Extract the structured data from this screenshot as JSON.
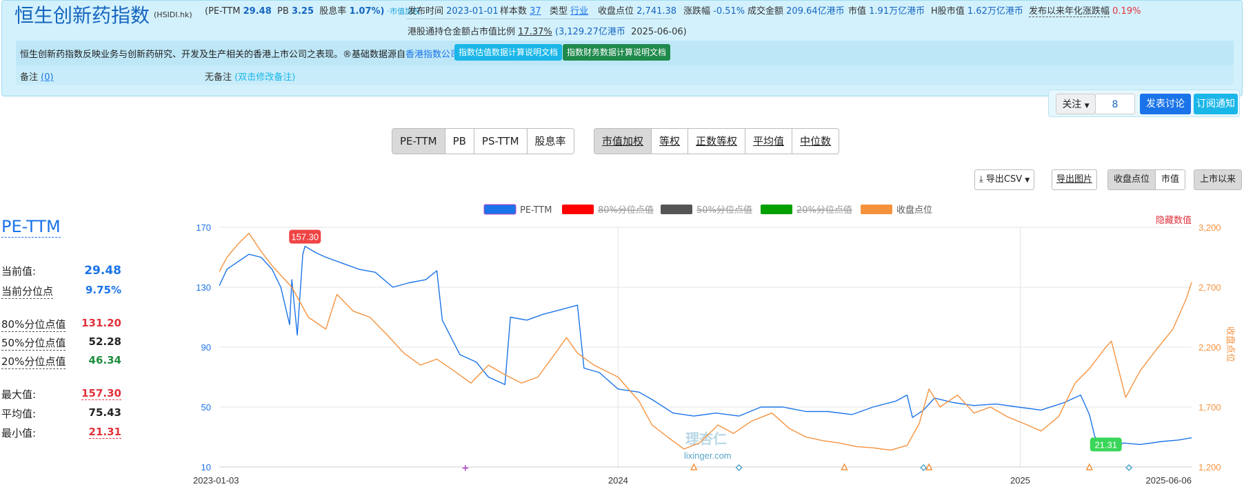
{
  "header": {
    "index_name": "恒生创新药指数",
    "index_code": "(HSIDI.hk)",
    "pe_label": "(PE-TTM",
    "pe_value": "29.48",
    "pb_label": "PB",
    "pb_value": "3.25",
    "dy_label": "股息率",
    "dy_value": "1.07%)",
    "weight_tag": "·市值加权",
    "publish_label": "发布时间",
    "publish_value": "2023-01-01",
    "sample_label": "样本数",
    "sample_value": "37",
    "type_label": "类型",
    "type_value": "行业",
    "close_label": "收盘点位",
    "close_value": "2,741.38",
    "change_label": "涨跌幅",
    "change_value": "-0.51%",
    "turnover_label": "成交金额",
    "turnover_value": "209.64亿港币",
    "mktcap_label": "市值",
    "mktcap_value": "1.91万亿港币",
    "hcap_label": "H股市值",
    "hcap_value": "1.62万亿港币",
    "annual_label": "发布以来年化涨跌幅",
    "annual_value": "0.19%",
    "southbound_label": "港股通持仓金额占市值比例",
    "southbound_pct": "17.37%",
    "southbound_amount": "(3,129.27亿港币",
    "southbound_date": "2025-06-06)",
    "description_prefix": "恒生创新药指数反映业务与创新药研究、开发及生产相关的香港上市公司之表现。®基础数据源自",
    "description_link": "香港指数公司",
    "description_suffix": "。",
    "doc_btn_valuation": "指数估值数据计算说明文档",
    "doc_btn_financial": "指数财务数据计算说明文档",
    "note_label": "备注",
    "note_count": "(0)",
    "note_value": "无备注",
    "note_edit": "(双击修改备注)"
  },
  "actions": {
    "follow": "关注",
    "follow_count": "8",
    "post": "发表讨论",
    "subscribe": "订阅通知"
  },
  "metric_tabs": [
    "PE-TTM",
    "PB",
    "PS-TTM",
    "股息率"
  ],
  "weight_tabs": [
    "市值加权",
    "等权",
    "正数等权",
    "平均值",
    "中位数"
  ],
  "tools": {
    "export_csv": "导出CSV",
    "export_img": "导出图片",
    "mode_close": "收盘点位",
    "mode_cap": "市值",
    "range": "上市以来"
  },
  "stats": {
    "title": "PE-TTM",
    "current_label": "当前值:",
    "current_value": "29.48",
    "pct_label": "当前分位点",
    "pct_value": "9.75%",
    "p80_label": "80%分位点值",
    "p80_value": "131.20",
    "p50_label": "50%分位点值",
    "p50_value": "52.28",
    "p20_label": "20%分位点值",
    "p20_value": "46.34",
    "max_label": "最大值:",
    "max_value": "157.30",
    "avg_label": "平均值:",
    "avg_value": "75.43",
    "min_label": "最小值:",
    "min_value": "21.31"
  },
  "colors": {
    "pe": "#1a73e8",
    "p80": "#ff0000",
    "p50": "#555555",
    "p20": "#00a000",
    "close": "#f5923e",
    "red": "#e0313b",
    "green": "#1e8e3e"
  },
  "chart_data": {
    "type": "line",
    "legend": [
      "PE-TTM",
      "80%分位点值",
      "50%分位点值",
      "20%分位点值",
      "收盘点位"
    ],
    "hidden_series": [
      "80%分位点值",
      "50%分位点值",
      "20%分位点值"
    ],
    "legend_position": "top-center",
    "hide_values_label": "隐藏数值",
    "y_left_ticks": [
      10,
      50,
      90,
      130,
      170
    ],
    "y_left_range": [
      10,
      170
    ],
    "y_right_ticks": [
      1200,
      1700,
      2200,
      2700,
      3200
    ],
    "y_right_tick_labels": [
      "1,200",
      "1,700",
      "2,200",
      "2,700",
      "3,200"
    ],
    "y_right_range": [
      1200,
      3200
    ],
    "y_right_label": "收盘点位",
    "x_range": [
      "2023-01-03",
      "2025-06-06"
    ],
    "x_tick_labels": [
      "2023-01-03",
      "2024",
      "2025",
      "2025-06-06"
    ],
    "x_ticks": [
      "2023-01-03",
      "2024-01-01",
      "2025-01-01",
      "2025-06-06"
    ],
    "grid": true,
    "annotations": [
      {
        "label": "157.30",
        "date": "2023-03-22",
        "value": 157.3,
        "kind": "max"
      },
      {
        "label": "21.31",
        "date": "2025-03-20",
        "value": 21.31,
        "kind": "min"
      }
    ],
    "watermark": [
      "理杏仁",
      "lixinger.com"
    ],
    "series": [
      {
        "name": "PE-TTM",
        "axis": "left",
        "points": [
          [
            "2023-01-03",
            131
          ],
          [
            "2023-01-10",
            142
          ],
          [
            "2023-01-20",
            147
          ],
          [
            "2023-01-30",
            152
          ],
          [
            "2023-02-10",
            150
          ],
          [
            "2023-02-20",
            142
          ],
          [
            "2023-02-28",
            130
          ],
          [
            "2023-03-08",
            105
          ],
          [
            "2023-03-10",
            135
          ],
          [
            "2023-03-15",
            98
          ],
          [
            "2023-03-20",
            152
          ],
          [
            "2023-03-22",
            157.3
          ],
          [
            "2023-04-01",
            153
          ],
          [
            "2023-04-10",
            150
          ],
          [
            "2023-04-25",
            146
          ],
          [
            "2023-05-10",
            142
          ],
          [
            "2023-05-25",
            140
          ],
          [
            "2023-06-10",
            130
          ],
          [
            "2023-06-25",
            133
          ],
          [
            "2023-07-10",
            135
          ],
          [
            "2023-07-20",
            141
          ],
          [
            "2023-07-25",
            108
          ],
          [
            "2023-08-10",
            85
          ],
          [
            "2023-08-25",
            80
          ],
          [
            "2023-09-05",
            70
          ],
          [
            "2023-09-20",
            65
          ],
          [
            "2023-09-25",
            110
          ],
          [
            "2023-10-10",
            108
          ],
          [
            "2023-10-25",
            112
          ],
          [
            "2023-11-10",
            115
          ],
          [
            "2023-11-25",
            118
          ],
          [
            "2023-12-01",
            76
          ],
          [
            "2023-12-15",
            73
          ],
          [
            "2024-01-01",
            62
          ],
          [
            "2024-01-20",
            60
          ],
          [
            "2024-02-01",
            55
          ],
          [
            "2024-02-20",
            46
          ],
          [
            "2024-03-10",
            44
          ],
          [
            "2024-03-30",
            46
          ],
          [
            "2024-04-20",
            44
          ],
          [
            "2024-05-10",
            50
          ],
          [
            "2024-05-30",
            50
          ],
          [
            "2024-06-20",
            47
          ],
          [
            "2024-07-10",
            47
          ],
          [
            "2024-08-01",
            45
          ],
          [
            "2024-08-20",
            50
          ],
          [
            "2024-09-10",
            54
          ],
          [
            "2024-09-20",
            58
          ],
          [
            "2024-09-25",
            43
          ],
          [
            "2024-10-05",
            48
          ],
          [
            "2024-10-15",
            56
          ],
          [
            "2024-11-01",
            53
          ],
          [
            "2024-11-20",
            51
          ],
          [
            "2024-12-10",
            52
          ],
          [
            "2024-12-30",
            50
          ],
          [
            "2025-01-20",
            48
          ],
          [
            "2025-02-10",
            53
          ],
          [
            "2025-02-25",
            58
          ],
          [
            "2025-03-05",
            45
          ],
          [
            "2025-03-10",
            30
          ],
          [
            "2025-03-20",
            21.31
          ],
          [
            "2025-04-05",
            26
          ],
          [
            "2025-04-20",
            25
          ],
          [
            "2025-05-10",
            27
          ],
          [
            "2025-05-25",
            28
          ],
          [
            "2025-06-06",
            29.48
          ]
        ]
      },
      {
        "name": "收盘点位",
        "axis": "right",
        "points": [
          [
            "2023-01-03",
            2830
          ],
          [
            "2023-01-10",
            2950
          ],
          [
            "2023-01-20",
            3060
          ],
          [
            "2023-01-30",
            3150
          ],
          [
            "2023-02-10",
            3000
          ],
          [
            "2023-02-20",
            2880
          ],
          [
            "2023-02-28",
            2800
          ],
          [
            "2023-03-10",
            2700
          ],
          [
            "2023-03-25",
            2450
          ],
          [
            "2023-04-10",
            2350
          ],
          [
            "2023-04-20",
            2640
          ],
          [
            "2023-05-05",
            2500
          ],
          [
            "2023-05-20",
            2450
          ],
          [
            "2023-06-05",
            2300
          ],
          [
            "2023-06-20",
            2150
          ],
          [
            "2023-07-05",
            2050
          ],
          [
            "2023-07-20",
            2100
          ],
          [
            "2023-08-05",
            2000
          ],
          [
            "2023-08-20",
            1900
          ],
          [
            "2023-09-05",
            2050
          ],
          [
            "2023-09-20",
            1970
          ],
          [
            "2023-10-05",
            1900
          ],
          [
            "2023-10-20",
            1950
          ],
          [
            "2023-11-05",
            2150
          ],
          [
            "2023-11-15",
            2280
          ],
          [
            "2023-11-25",
            2150
          ],
          [
            "2023-12-10",
            2050
          ],
          [
            "2024-01-01",
            1950
          ],
          [
            "2024-01-20",
            1750
          ],
          [
            "2024-02-01",
            1550
          ],
          [
            "2024-02-15",
            1450
          ],
          [
            "2024-03-01",
            1350
          ],
          [
            "2024-03-15",
            1400
          ],
          [
            "2024-04-01",
            1550
          ],
          [
            "2024-04-15",
            1480
          ],
          [
            "2024-05-01",
            1580
          ],
          [
            "2024-05-20",
            1650
          ],
          [
            "2024-06-05",
            1520
          ],
          [
            "2024-06-20",
            1450
          ],
          [
            "2024-07-05",
            1420
          ],
          [
            "2024-07-20",
            1400
          ],
          [
            "2024-08-05",
            1370
          ],
          [
            "2024-08-20",
            1360
          ],
          [
            "2024-09-05",
            1340
          ],
          [
            "2024-09-20",
            1380
          ],
          [
            "2024-10-01",
            1560
          ],
          [
            "2024-10-10",
            1850
          ],
          [
            "2024-10-20",
            1700
          ],
          [
            "2024-11-05",
            1800
          ],
          [
            "2024-11-20",
            1650
          ],
          [
            "2024-12-05",
            1700
          ],
          [
            "2024-12-20",
            1620
          ],
          [
            "2025-01-05",
            1560
          ],
          [
            "2025-01-20",
            1500
          ],
          [
            "2025-02-05",
            1620
          ],
          [
            "2025-02-20",
            1900
          ],
          [
            "2025-03-05",
            2020
          ],
          [
            "2025-03-20",
            2200
          ],
          [
            "2025-03-25",
            2250
          ],
          [
            "2025-04-07",
            1780
          ],
          [
            "2025-04-20",
            2000
          ],
          [
            "2025-05-05",
            2180
          ],
          [
            "2025-05-20",
            2350
          ],
          [
            "2025-06-01",
            2600
          ],
          [
            "2025-06-06",
            2741.38
          ]
        ]
      }
    ],
    "event_markers": [
      {
        "date": "2023-08-15",
        "shape": "plus",
        "color": "#a020c0"
      },
      {
        "date": "2024-03-10",
        "shape": "triangle",
        "color": "#f5923e"
      },
      {
        "date": "2024-04-20",
        "shape": "diamond",
        "color": "#4aa3c8"
      },
      {
        "date": "2024-07-25",
        "shape": "triangle",
        "color": "#f5923e"
      },
      {
        "date": "2024-10-05",
        "shape": "diamond",
        "color": "#4aa3c8"
      },
      {
        "date": "2024-10-10",
        "shape": "triangle",
        "color": "#f5923e"
      },
      {
        "date": "2025-03-05",
        "shape": "triangle",
        "color": "#f5923e"
      },
      {
        "date": "2025-04-10",
        "shape": "diamond",
        "color": "#4aa3c8"
      }
    ]
  }
}
